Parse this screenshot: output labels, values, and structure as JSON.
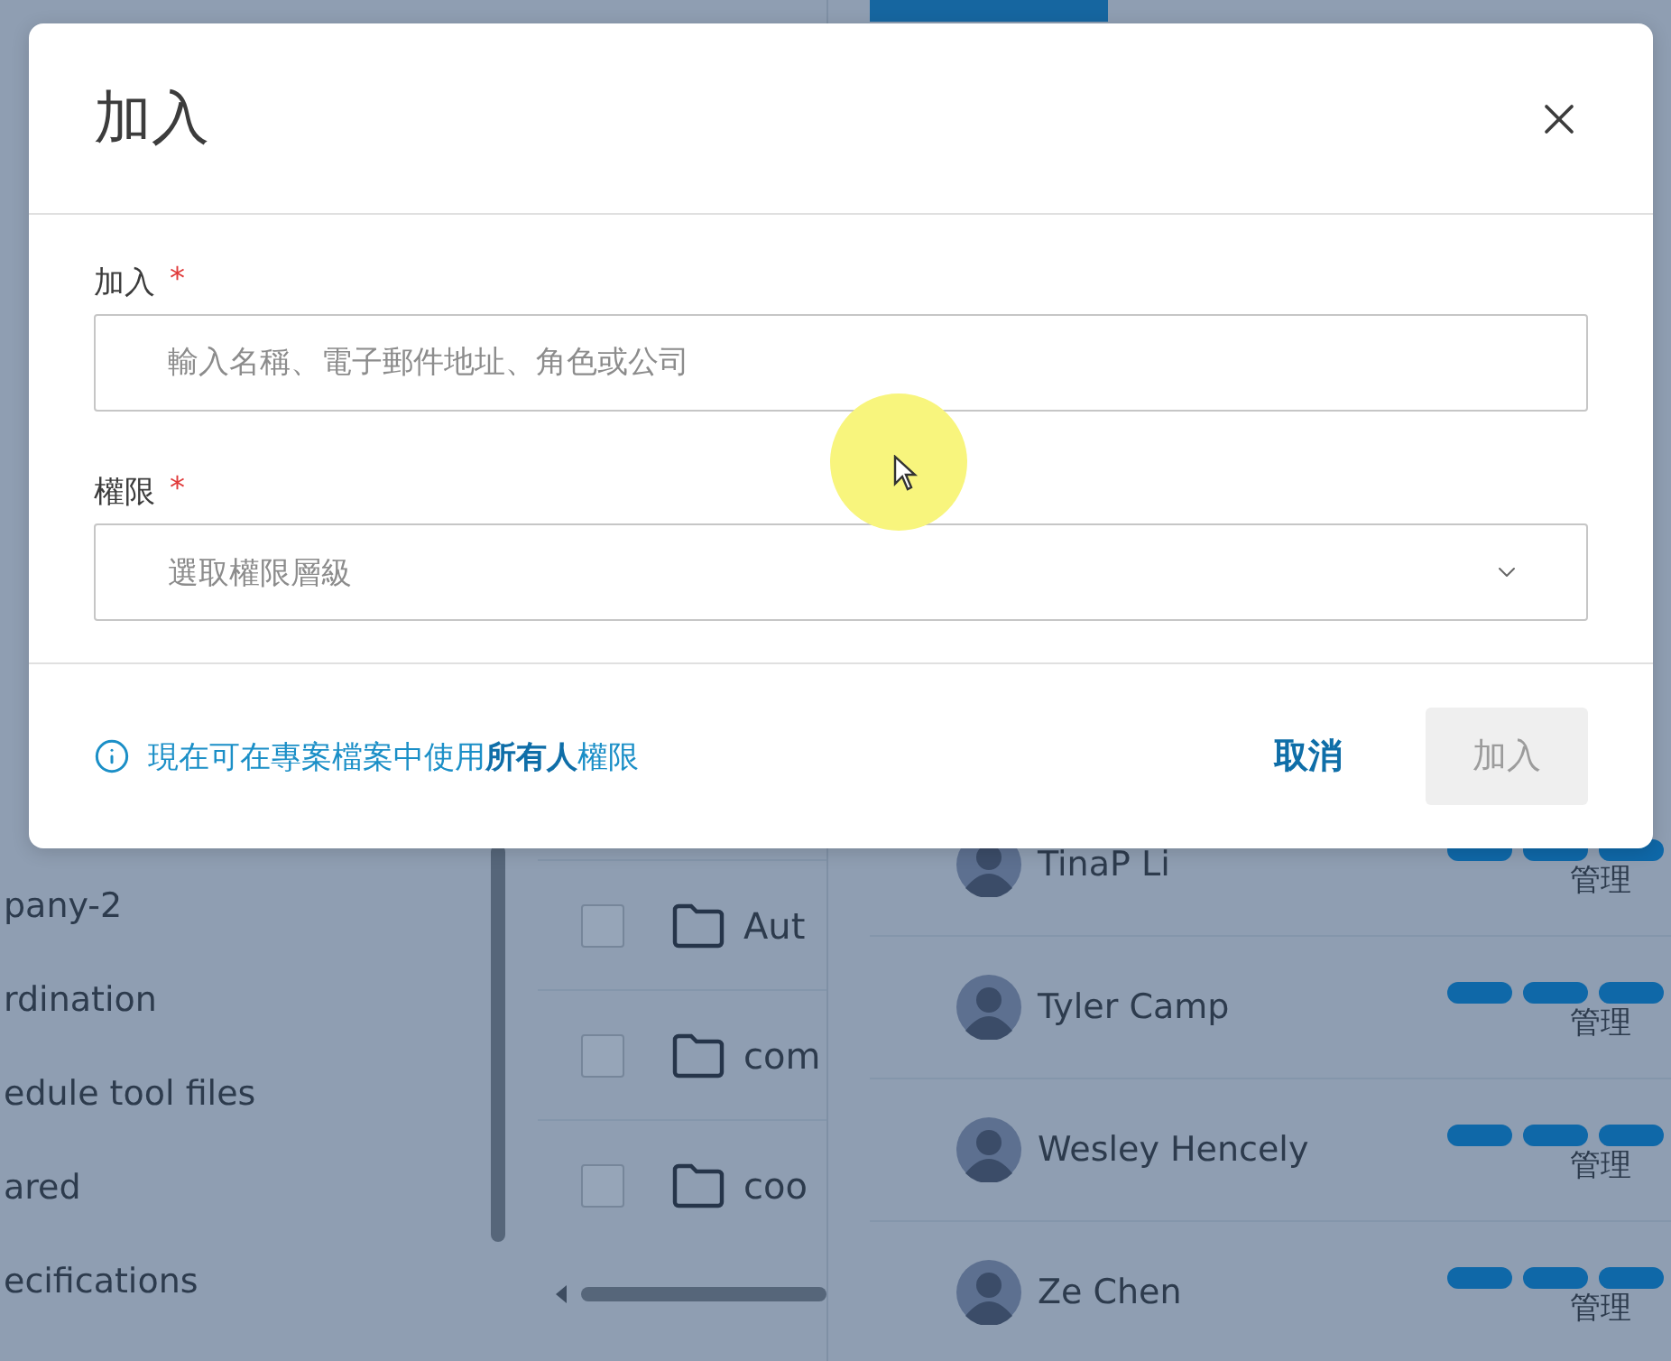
{
  "background": {
    "sidebar": {
      "items": [
        "pany-2",
        "rdination",
        "edule tool files",
        "ared",
        "ecifications"
      ]
    },
    "files": {
      "rows": [
        {
          "name": "Aut",
          "checked": false
        },
        {
          "name": "com",
          "checked": false
        },
        {
          "name": "coo",
          "checked": false
        }
      ]
    },
    "members": {
      "rows": [
        {
          "name": "TinaP Li",
          "role": "管理"
        },
        {
          "name": "Tyler Camp",
          "role": "管理"
        },
        {
          "name": "Wesley Hencely",
          "role": "管理"
        },
        {
          "name": "Ze Chen",
          "role": "管理"
        }
      ]
    }
  },
  "dialog": {
    "title": "加入",
    "fields": [
      {
        "kind": "text",
        "label": "加入",
        "required_mark": "*",
        "placeholder": "輸入名稱、電子郵件地址、角色或公司"
      },
      {
        "kind": "select",
        "label": "權限",
        "required_mark": "*",
        "placeholder": "選取權限層級"
      }
    ],
    "info": "現在可在專案檔案中使用**所有人**權限",
    "cancel": {
      "label": "取消",
      "disabled": false
    },
    "submit": {
      "label": "加入",
      "disabled": true
    }
  }
}
